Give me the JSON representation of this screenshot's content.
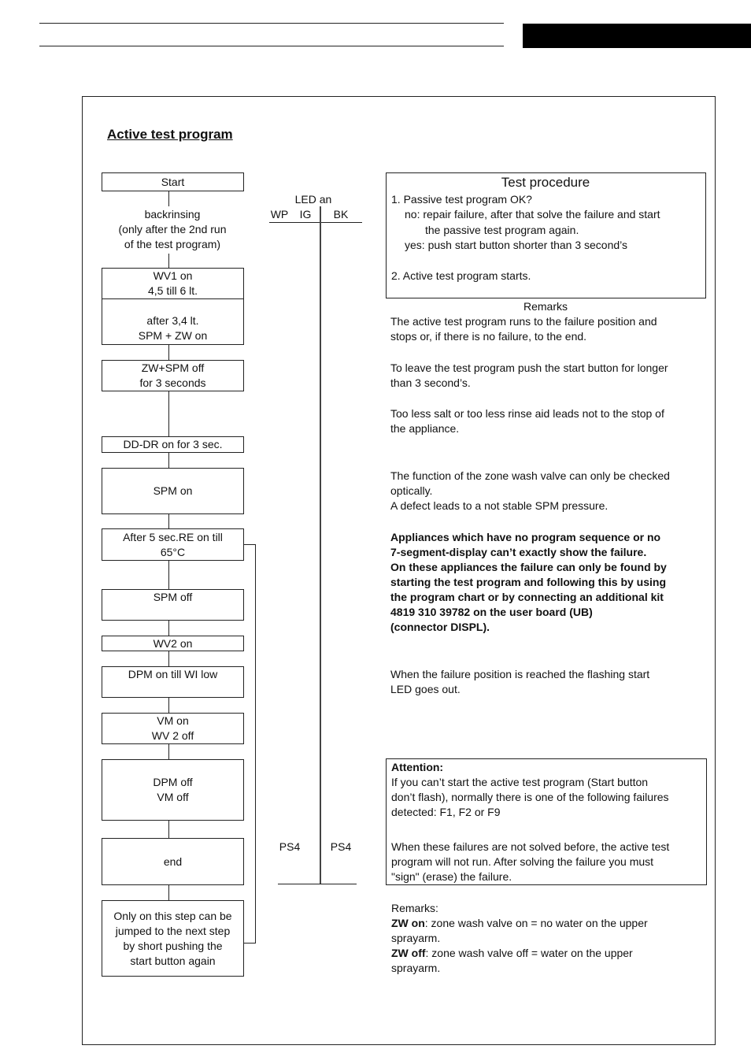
{
  "title": "Active test program",
  "flow": {
    "start": "Start",
    "backrinsing": [
      "backrinsing",
      "(only after the 2nd run",
      "of the test program)"
    ],
    "wv1": [
      "WV1 on",
      "4,5 till 6 lt."
    ],
    "after34": [
      "after 3,4 lt.",
      "SPM + ZW on"
    ],
    "zwspmoff": [
      "ZW+SPM off",
      "for 3 seconds"
    ],
    "dddr": "DD-DR on for 3 sec.",
    "spmon": "SPM on",
    "after5": [
      "After 5 sec.RE on till",
      "65°C"
    ],
    "spmoff": "SPM off",
    "wv2on": "WV2 on",
    "dpmon": "DPM on till WI low",
    "vmon": [
      "VM on",
      "WV 2 off"
    ],
    "dpmoff": [
      "DPM off",
      "VM off"
    ],
    "end": "end",
    "onlyon": [
      "Only on this step can be",
      "jumped to the next step",
      "by short pushing the",
      "start button again"
    ]
  },
  "led": {
    "title": "LED an",
    "cols": [
      "WP",
      "IG",
      "BK"
    ],
    "ps4_left": "PS4",
    "ps4_right": "PS4"
  },
  "procedure": {
    "title": "Test procedure",
    "lines": [
      "1. Passive test program OK?",
      "no: repair failure, after that solve the failure and start",
      "the passive test program again.",
      "yes: push start button shorter than 3 second’s",
      "2. Active test program starts."
    ]
  },
  "remarks": {
    "title": "Remarks",
    "p1": [
      "The active test program runs to the failure position and",
      "stops or, if there is no failure, to the end."
    ],
    "p2": [
      "To leave the test program push the start button for longer",
      "than 3 second’s."
    ],
    "p3": [
      "Too less salt or too less rinse aid leads not to the stop of",
      "the appliance."
    ],
    "p4": [
      "The function of the zone wash valve can only be checked",
      "optically.",
      "A defect leads to a not stable SPM pressure."
    ],
    "bold": [
      "Appliances which have no program sequence or no",
      "7-segment-display can’t exactly show the failure.",
      "On these appliances the failure can only be found by",
      "starting the test program and following this by using",
      "the program chart or by connecting an additional kit",
      "4819 310 39782 on the user board (UB)",
      "(connector DISPL)."
    ],
    "p5": [
      "When the failure position is reached the flashing start",
      "LED goes out."
    ]
  },
  "attention": {
    "title": "Attention:",
    "lines": [
      "If you can’t start the active test program (Start button",
      "don’t flash), normally there is one of the following failures",
      "detected: F1, F2 or F9"
    ],
    "lines2": [
      "When these failures are not solved before, the active test",
      "program will not run. After solving the failure you must",
      "\"sign\" (erase) the failure."
    ]
  },
  "footer": {
    "title": "Remarks:",
    "zwon_term": "ZW on",
    "zwon_text": ": zone wash valve on = no water on the upper",
    "zwon_cont": "sprayarm.",
    "zwoff_term": "ZW off",
    "zwoff_text": ": zone wash valve off = water on the upper",
    "zwoff_cont": "sprayarm."
  }
}
